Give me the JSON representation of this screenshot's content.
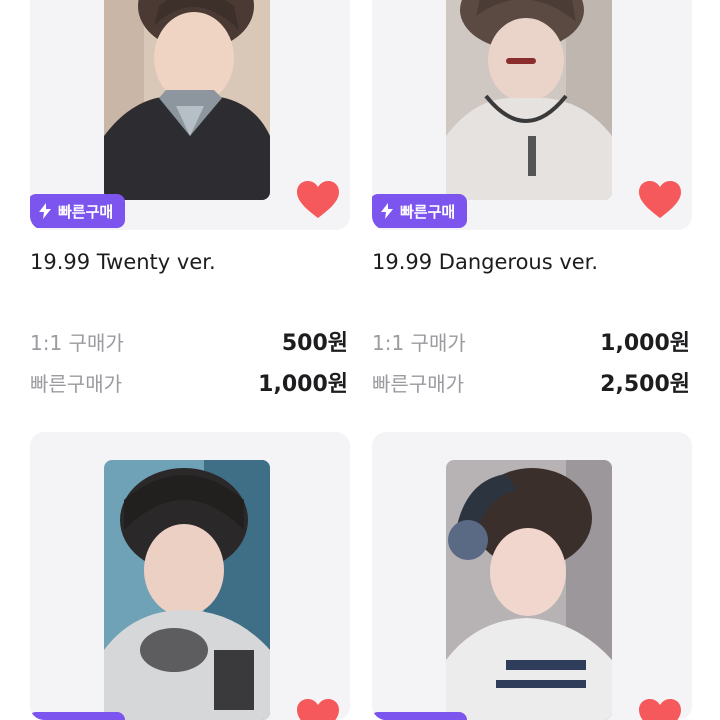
{
  "badge_label": "빠른구매",
  "brand_color": "#7b55ee",
  "heart_color": "#f5595c",
  "products": [
    {
      "title": "19.99 Twenty ver.",
      "price_1to1_label": "1:1 구매가",
      "price_1to1": "500원",
      "price_quick_label": "빠른구매가",
      "price_quick": "1,000원",
      "liked": true
    },
    {
      "title": "19.99 Dangerous ver.",
      "price_1to1_label": "1:1 구매가",
      "price_1to1": "1,000원",
      "price_quick_label": "빠른구매가",
      "price_quick": "2,500원",
      "liked": true
    },
    {
      "liked": true
    },
    {
      "liked": true
    }
  ]
}
